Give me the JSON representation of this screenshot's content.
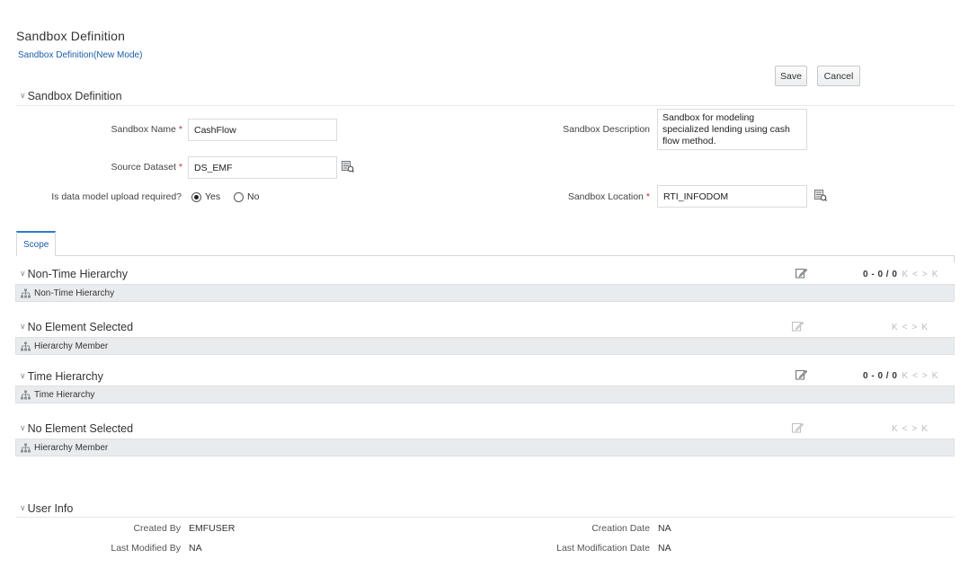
{
  "page": {
    "title": "Sandbox Definition",
    "breadcrumb": "Sandbox Definition(New Mode)"
  },
  "toolbar": {
    "save_label": "Save",
    "cancel_label": "Cancel"
  },
  "sandbox_section": {
    "heading": "Sandbox Definition",
    "name_label": "Sandbox Name",
    "name_value": "CashFlow",
    "dataset_label": "Source Dataset",
    "dataset_value": "DS_EMF",
    "upload_label": "Is data model upload required?",
    "upload_yes": "Yes",
    "upload_no": "No",
    "upload_selected": "Yes",
    "description_label": "Sandbox Description",
    "description_value": "Sandbox for modeling specialized lending using cash flow method.",
    "location_label": "Sandbox Location",
    "location_value": "RTI_INFODOM",
    "required_mark": "*"
  },
  "tabs": [
    {
      "label": "Scope",
      "active": true
    }
  ],
  "scope": {
    "groups": [
      {
        "heading": "Non-Time Hierarchy",
        "bar_label": "Non-Time Hierarchy",
        "pager": "0 - 0 / 0",
        "edit_enabled": true
      },
      {
        "heading": "No Element Selected",
        "bar_label": "Hierarchy Member",
        "pager": "",
        "edit_enabled": false
      },
      {
        "heading": "Time Hierarchy",
        "bar_label": "Time Hierarchy",
        "pager": "0 - 0 / 0",
        "edit_enabled": true
      },
      {
        "heading": "No Element Selected",
        "bar_label": "Hierarchy Member",
        "pager": "",
        "edit_enabled": false
      }
    ],
    "pager_nav": [
      "K",
      "<",
      ">",
      "K"
    ]
  },
  "user_info": {
    "heading": "User Info",
    "created_by_label": "Created By",
    "created_by_value": "EMFUSER",
    "last_modified_by_label": "Last Modified By",
    "last_modified_by_value": "NA",
    "creation_date_label": "Creation Date",
    "creation_date_value": "NA",
    "last_modification_date_label": "Last Modification Date",
    "last_modification_date_value": "NA"
  },
  "colors": {
    "link_blue": "#1b5ea8",
    "tab_accent": "#2f7bc8",
    "required_red": "#c52b2b",
    "bar_bg": "#e9ecee"
  },
  "icons": {
    "lookup": "lookup-hierarchy-icon",
    "edit": "edit-icon",
    "hierarchy": "hierarchy-tree-icon",
    "chevron": "chevron-down-icon"
  }
}
